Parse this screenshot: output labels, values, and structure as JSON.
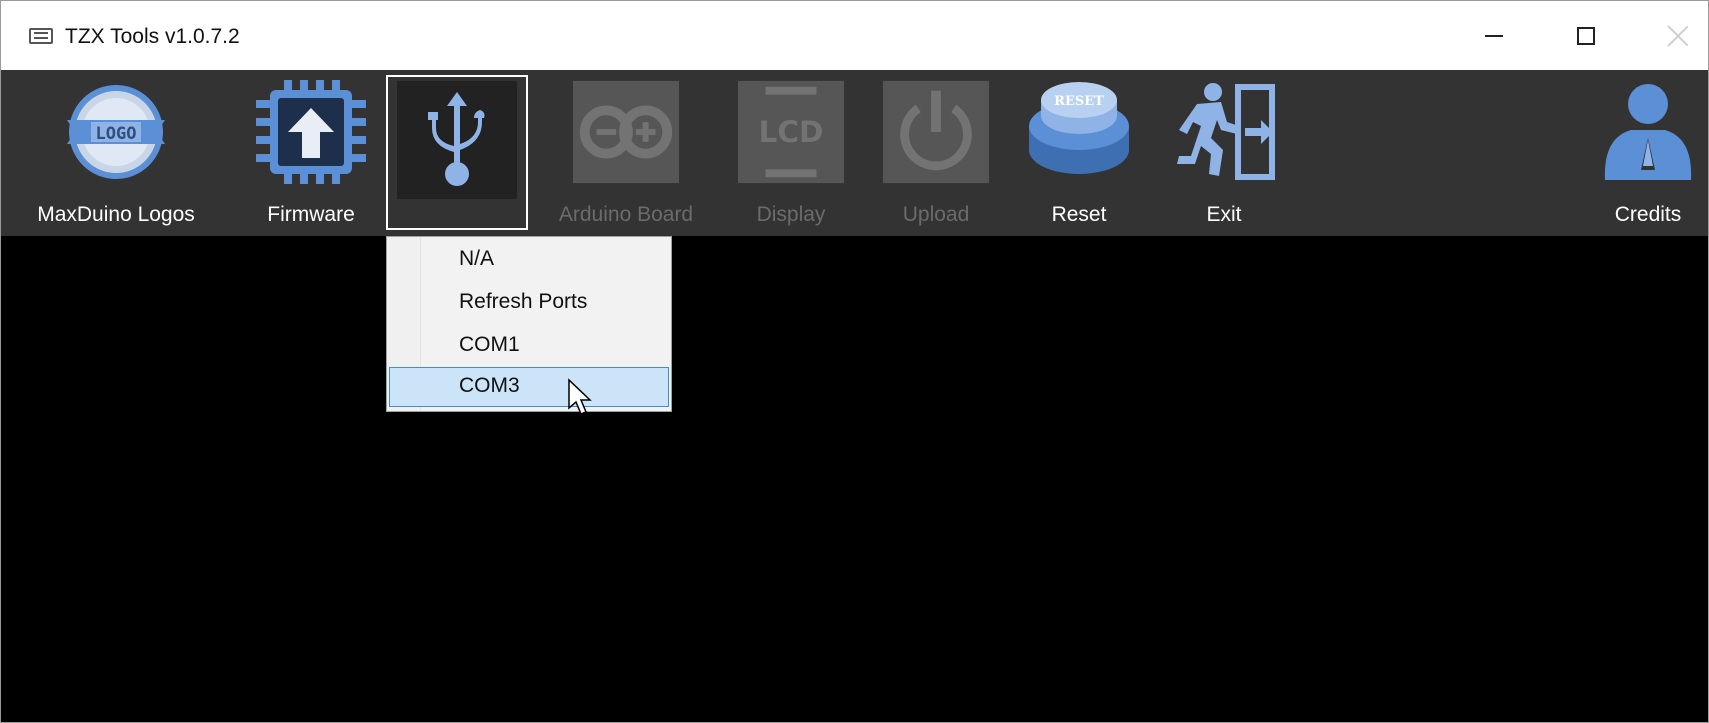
{
  "window": {
    "title": "TZX Tools v1.0.7.2",
    "icon": "keyboard-app-icon",
    "controls": {
      "minimize": "minimize-icon",
      "maximize": "maximize-icon",
      "close": "close-icon"
    }
  },
  "toolbar": {
    "items": [
      {
        "label": "MaxDuino Logos",
        "icon": "logo-badge-icon",
        "enabled": true
      },
      {
        "label": "Firmware",
        "icon": "chip-upload-icon",
        "enabled": true
      },
      {
        "label": "",
        "icon": "usb-icon",
        "enabled": true,
        "pressed": true
      },
      {
        "label": "Arduino Board",
        "icon": "arduino-icon",
        "enabled": false
      },
      {
        "label": "Display",
        "icon": "lcd-icon",
        "enabled": false
      },
      {
        "label": "Upload",
        "icon": "power-icon",
        "enabled": false
      },
      {
        "label": "Reset",
        "icon": "reset-button-icon",
        "enabled": true
      },
      {
        "label": "Exit",
        "icon": "exit-door-icon",
        "enabled": true
      },
      {
        "label": "Credits",
        "icon": "praying-person-icon",
        "enabled": true
      }
    ]
  },
  "port_menu": {
    "items": [
      {
        "label": "N/A"
      },
      {
        "label": "Refresh Ports"
      },
      {
        "label": "COM1"
      },
      {
        "label": "COM3",
        "selected": true
      }
    ]
  },
  "colors": {
    "toolbar_bg": "#333333",
    "content_bg": "#000000",
    "icon_blue": "#5b8fd6",
    "menu_highlight": "#cce4f7",
    "menu_highlight_border": "#3e8ed0"
  }
}
